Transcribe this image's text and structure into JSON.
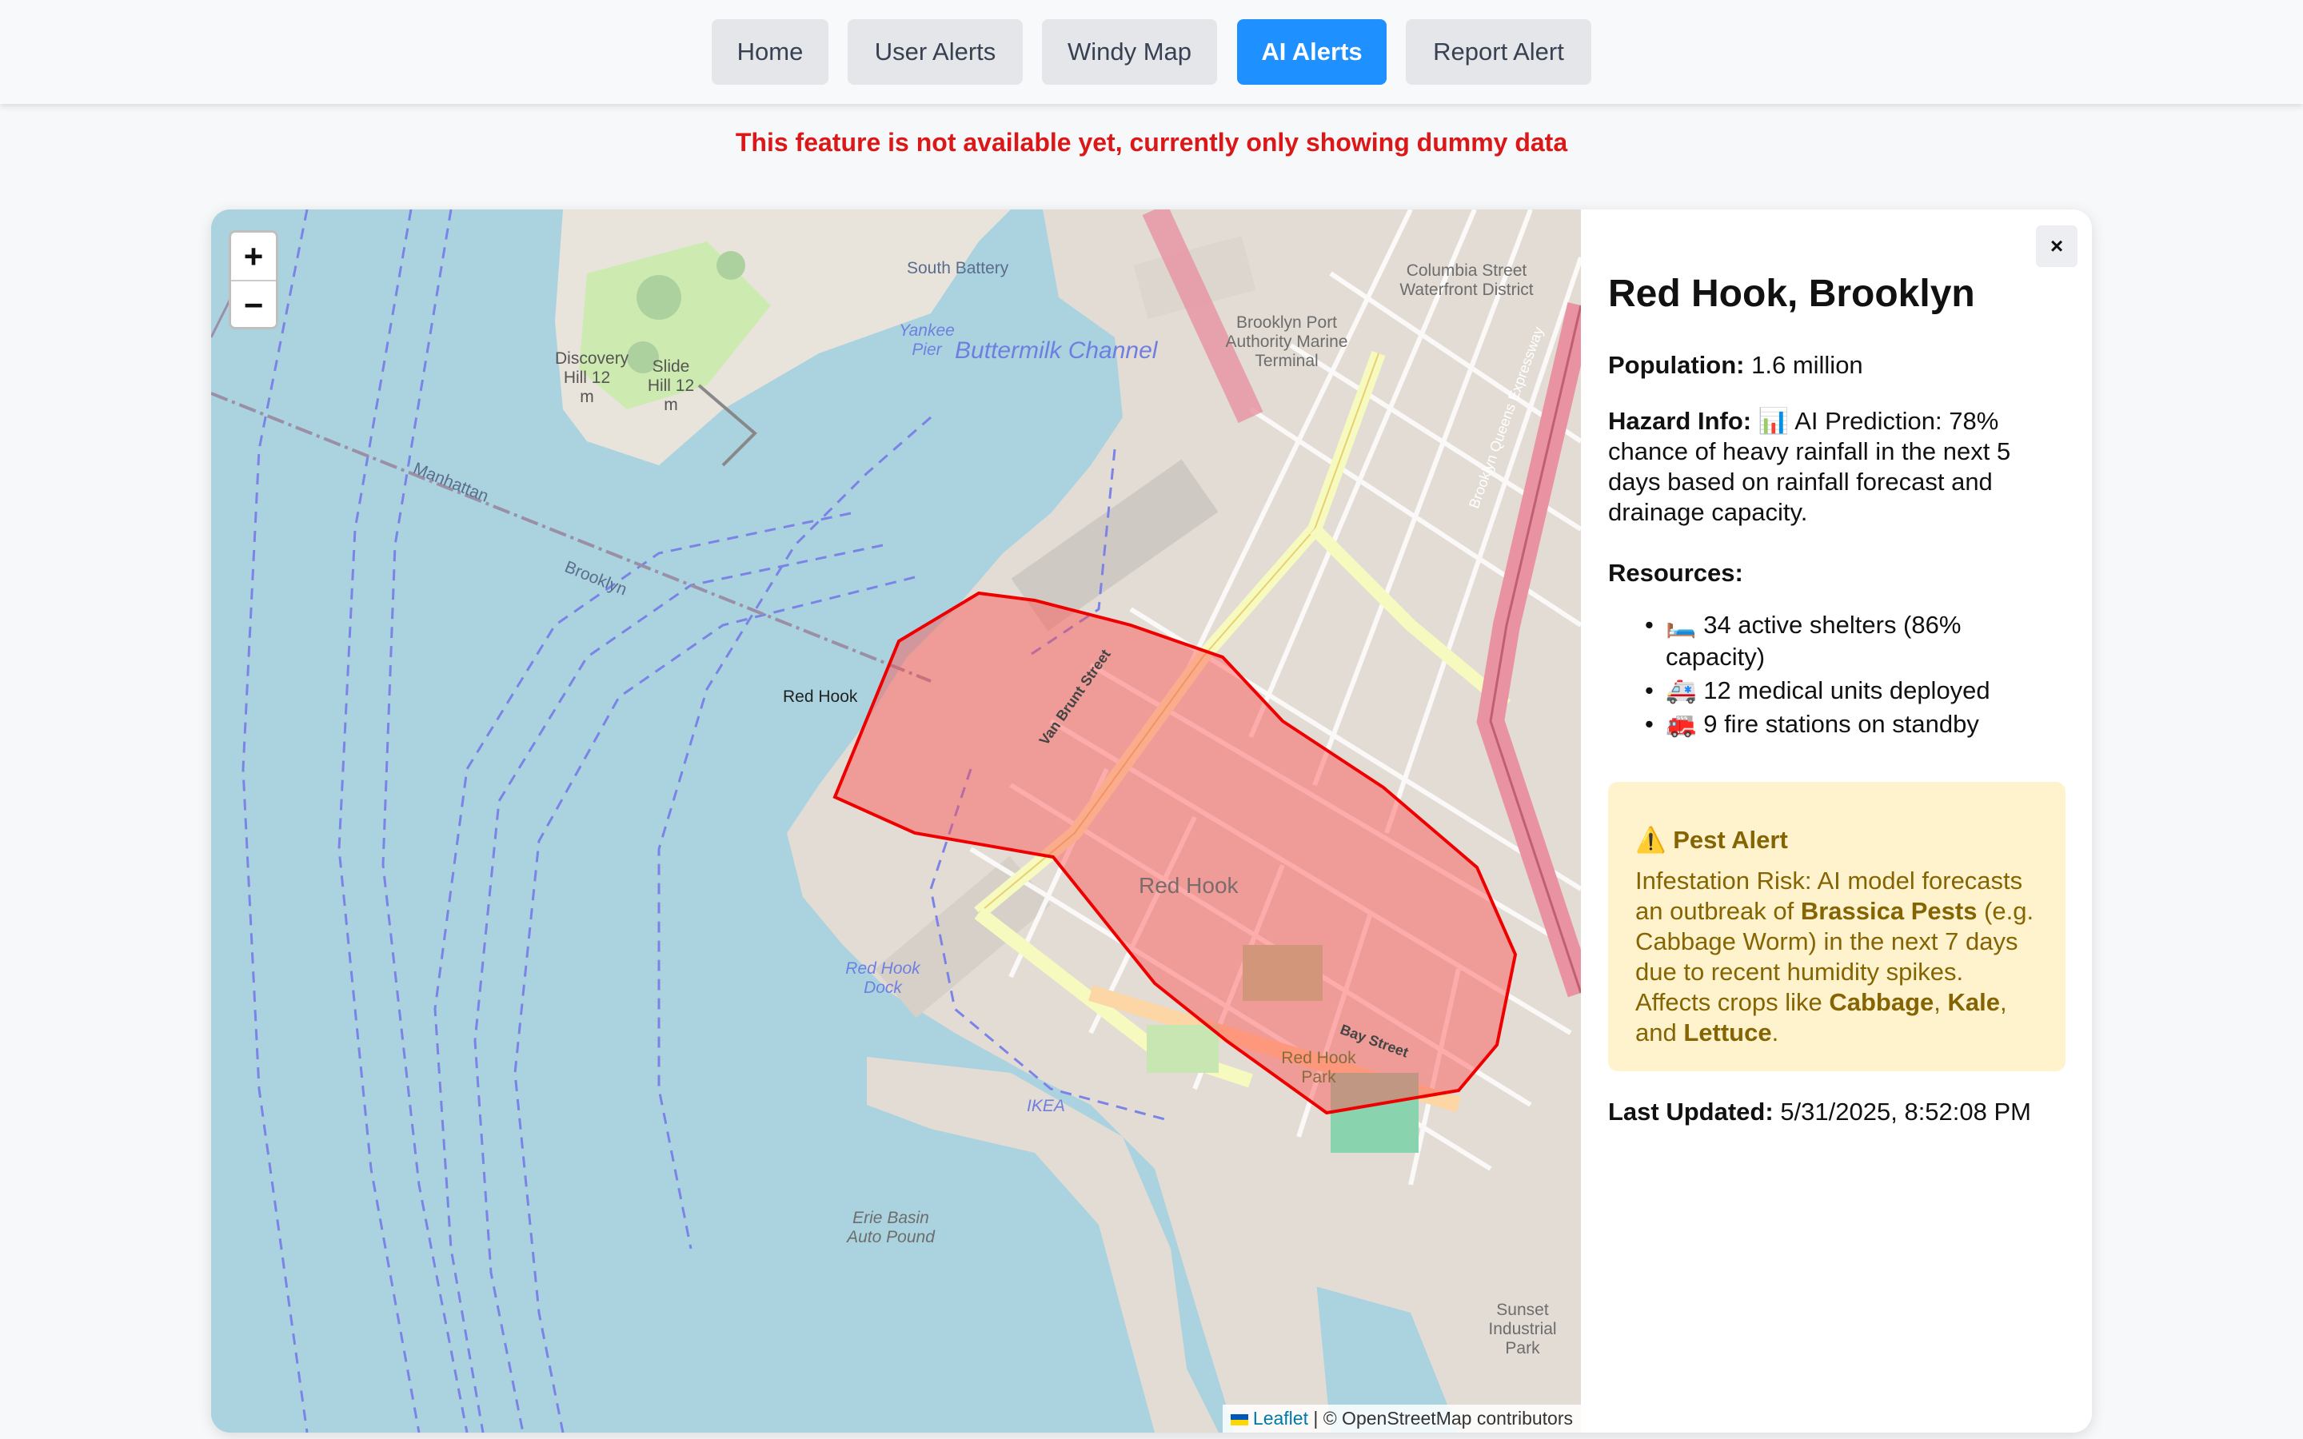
{
  "nav": {
    "items": [
      {
        "label": "Home",
        "active": false
      },
      {
        "label": "User Alerts",
        "active": false
      },
      {
        "label": "Windy Map",
        "active": false
      },
      {
        "label": "AI Alerts",
        "active": true
      },
      {
        "label": "Report Alert",
        "active": false
      }
    ]
  },
  "notice": "This feature is not available yet, currently only showing dummy data",
  "map": {
    "zoom_in": "+",
    "zoom_out": "−",
    "attribution_leaflet": "Leaflet",
    "attribution_rest": "| © OpenStreetMap contributors",
    "labels": {
      "south_battery": "South Battery",
      "buttermilk_channel": "Buttermilk Channel",
      "manhattan": "Manhattan",
      "brooklyn": "Brooklyn",
      "red_hook_small": "Red Hook",
      "red_hook_big": "Red Hook",
      "red_hook_dock": "Red Hook Dock",
      "red_hook_park": "Red Hook Park",
      "erie_basin": "Erie Basin Auto Pound",
      "brooklyn_port": "Brooklyn Port Authority Marine Terminal",
      "columbia_waterfront": "Columbia Street Waterfront District",
      "sunset_industrial": "Sunset Industrial Park",
      "discovery_hill": "Discovery Hill 12 m",
      "slide_hill": "Slide Hill 12 m",
      "van_brunt": "Van Brunt Street",
      "bay_street": "Bay Street",
      "bqe": "Brooklyn Queens Expressway",
      "ikea": "IKEA",
      "yankee_pier": "Yankee Pier"
    },
    "alert_color": "#ff0000"
  },
  "panel": {
    "close_label": "×",
    "title": "Red Hook, Brooklyn",
    "population_label": "Population:",
    "population_value": "1.6 million",
    "hazard_label": "Hazard Info:",
    "hazard_value": "📊 AI Prediction: 78% chance of heavy rainfall in the next 5 days based on rainfall forecast and drainage capacity.",
    "resources_label": "Resources:",
    "resources": [
      "🛏️ 34 active shelters (86% capacity)",
      "🚑 12 medical units deployed",
      "🚒 9 fire stations on standby"
    ],
    "pest": {
      "title": "⚠️ Pest Alert",
      "text_1": "Infestation Risk: AI model forecasts an outbreak of ",
      "bold_1": "Brassica Pests",
      "text_2": " (e.g. Cabbage Worm) in the next 7 days due to recent humidity spikes. Affects crops like ",
      "crop_1": "Cabbage",
      "sep_1": ", ",
      "crop_2": "Kale",
      "sep_2": ", and ",
      "crop_3": "Lettuce",
      "end": "."
    },
    "updated_label": "Last Updated:",
    "updated_value": "5/31/2025, 8:52:08 PM"
  }
}
